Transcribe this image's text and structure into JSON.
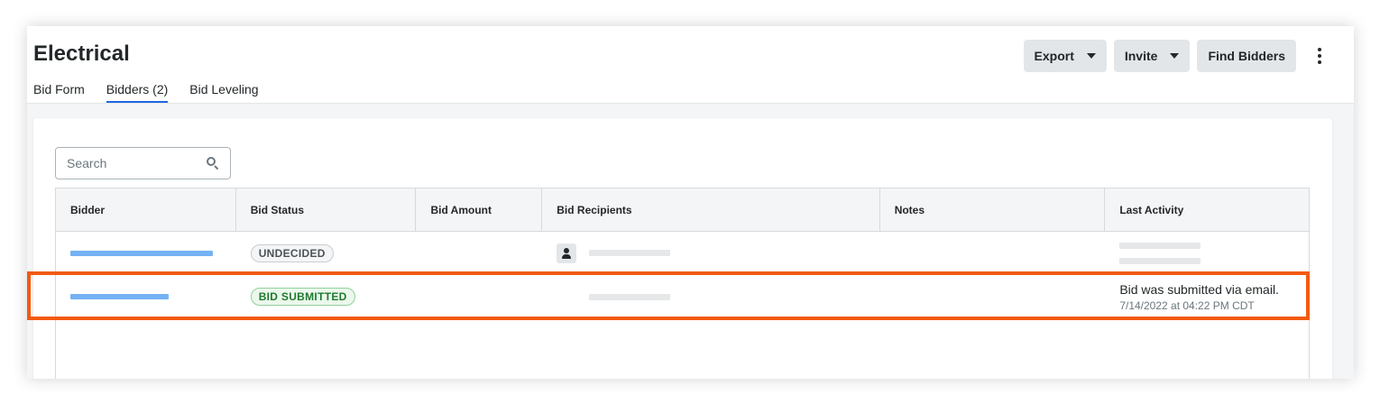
{
  "header": {
    "title": "Electrical",
    "tabs": [
      {
        "label": "Bid Form",
        "active": false
      },
      {
        "label": "Bidders (2)",
        "active": true
      },
      {
        "label": "Bid Leveling",
        "active": false
      }
    ],
    "buttons": {
      "export": "Export",
      "invite": "Invite",
      "find_bidders": "Find Bidders"
    }
  },
  "search": {
    "placeholder": "Search",
    "icon": "search-icon"
  },
  "table": {
    "columns": [
      "Bidder",
      "Bid Status",
      "Bid Amount",
      "Bid Recipients",
      "Notes",
      "Last Activity"
    ],
    "rows": [
      {
        "bid_status": "UNDECIDED",
        "recipient_icon": "person-icon",
        "last_activity": "",
        "last_activity_time": ""
      },
      {
        "bid_status": "BID SUBMITTED",
        "last_activity": "Bid was submitted via email.",
        "last_activity_time": "7/14/2022 at 04:22 PM CDT",
        "highlighted": true
      }
    ]
  },
  "colors": {
    "accent": "#2066df",
    "link_placeholder": "#75b2f4",
    "highlight": "#f25a0f",
    "submitted_green": "#1f7a2e"
  }
}
